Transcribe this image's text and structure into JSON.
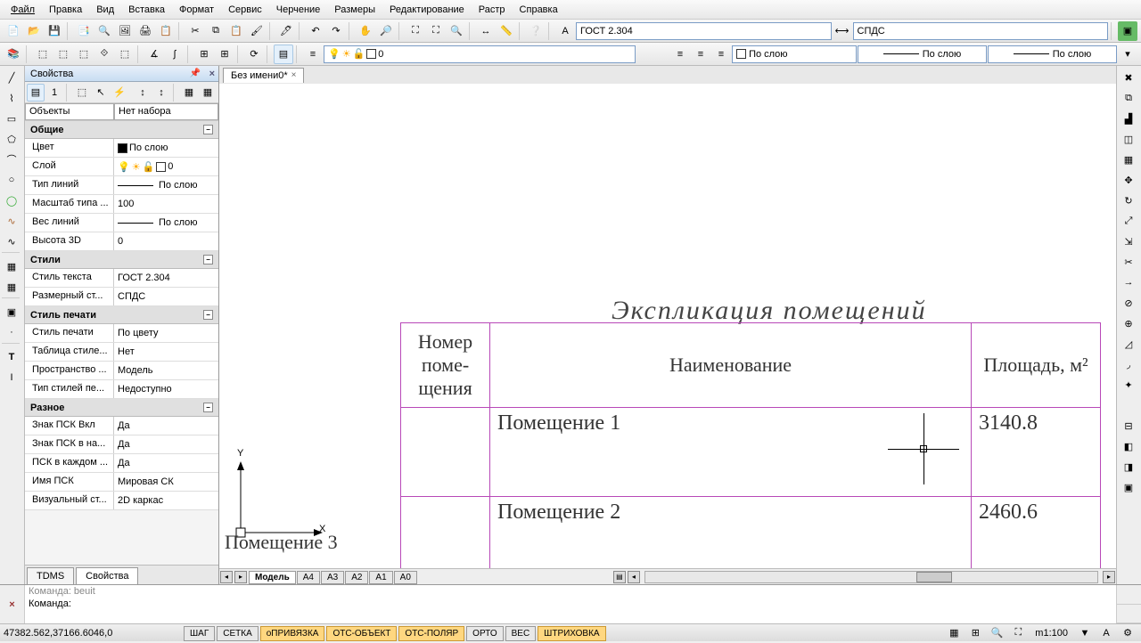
{
  "menu": [
    "Файл",
    "Правка",
    "Вид",
    "Вставка",
    "Формат",
    "Сервис",
    "Черчение",
    "Размеры",
    "Редактирование",
    "Растр",
    "Справка"
  ],
  "toolbar2": {
    "layer": "0",
    "text_style": "ГОСТ 2.304",
    "dim_style": "СПДС",
    "color": "По слою",
    "ltype": "По слою",
    "lweight": "По слою"
  },
  "props": {
    "title": "Свойства",
    "object_label": "Объекты",
    "object_value": "Нет набора",
    "groups": [
      {
        "name": "Общие",
        "rows": [
          {
            "label": "Цвет",
            "value": "По слою",
            "swatch": "#000"
          },
          {
            "label": "Слой",
            "value": "0",
            "icons": true
          },
          {
            "label": "Тип линий",
            "value": "По слою",
            "line": true
          },
          {
            "label": "Масштаб типа ...",
            "value": "100"
          },
          {
            "label": "Вес линий",
            "value": "По слою",
            "line": true
          },
          {
            "label": "Высота 3D",
            "value": "0"
          }
        ]
      },
      {
        "name": "Стили",
        "rows": [
          {
            "label": "Стиль текста",
            "value": "ГОСТ 2.304"
          },
          {
            "label": "Размерный ст...",
            "value": "СПДС"
          }
        ]
      },
      {
        "name": "Стиль печати",
        "rows": [
          {
            "label": "Стиль печати",
            "value": "По цвету"
          },
          {
            "label": "Таблица стиле...",
            "value": "Нет"
          },
          {
            "label": "Пространство ...",
            "value": "Модель"
          },
          {
            "label": "Тип стилей пе...",
            "value": "Недоступно"
          }
        ]
      },
      {
        "name": "Разное",
        "rows": [
          {
            "label": "Знак ПСК Вкл",
            "value": "Да"
          },
          {
            "label": "Знак ПСК в на...",
            "value": "Да"
          },
          {
            "label": "ПСК в каждом ...",
            "value": "Да"
          },
          {
            "label": "Имя ПСК",
            "value": "Мировая СК"
          },
          {
            "label": "Визуальный ст...",
            "value": "2D каркас"
          }
        ]
      }
    ],
    "tabs": [
      "TDMS",
      "Свойства"
    ]
  },
  "doc_tab": "Без имени0*",
  "drawing": {
    "title": "Экспликация помещений",
    "headers": [
      "Номер поме-щения",
      "Наименование",
      "Площадь, м²"
    ],
    "rows": [
      {
        "name": "Помещение 1",
        "area": "3140.8"
      },
      {
        "name": "Помещение 2",
        "area": "2460.6"
      }
    ],
    "extra": "Помещение 3"
  },
  "layout_tabs": [
    "Модель",
    "A4",
    "A3",
    "A2",
    "A1",
    "A0"
  ],
  "cmd": {
    "prev": "Команда: beuit",
    "current": "Команда:"
  },
  "status": {
    "coords": "47382.562,37166.6046,0",
    "toggles": [
      {
        "t": "ШАГ",
        "on": false
      },
      {
        "t": "СЕТКА",
        "on": false
      },
      {
        "t": "оПРИВЯЗКА",
        "on": true
      },
      {
        "t": "ОТС-ОБЪЕКТ",
        "on": true
      },
      {
        "t": "ОТС-ПОЛЯР",
        "on": true
      },
      {
        "t": "ОРТО",
        "on": false
      },
      {
        "t": "ВЕС",
        "on": false
      },
      {
        "t": "ШТРИХОВКА",
        "on": true
      }
    ],
    "scale": "m1:100"
  }
}
